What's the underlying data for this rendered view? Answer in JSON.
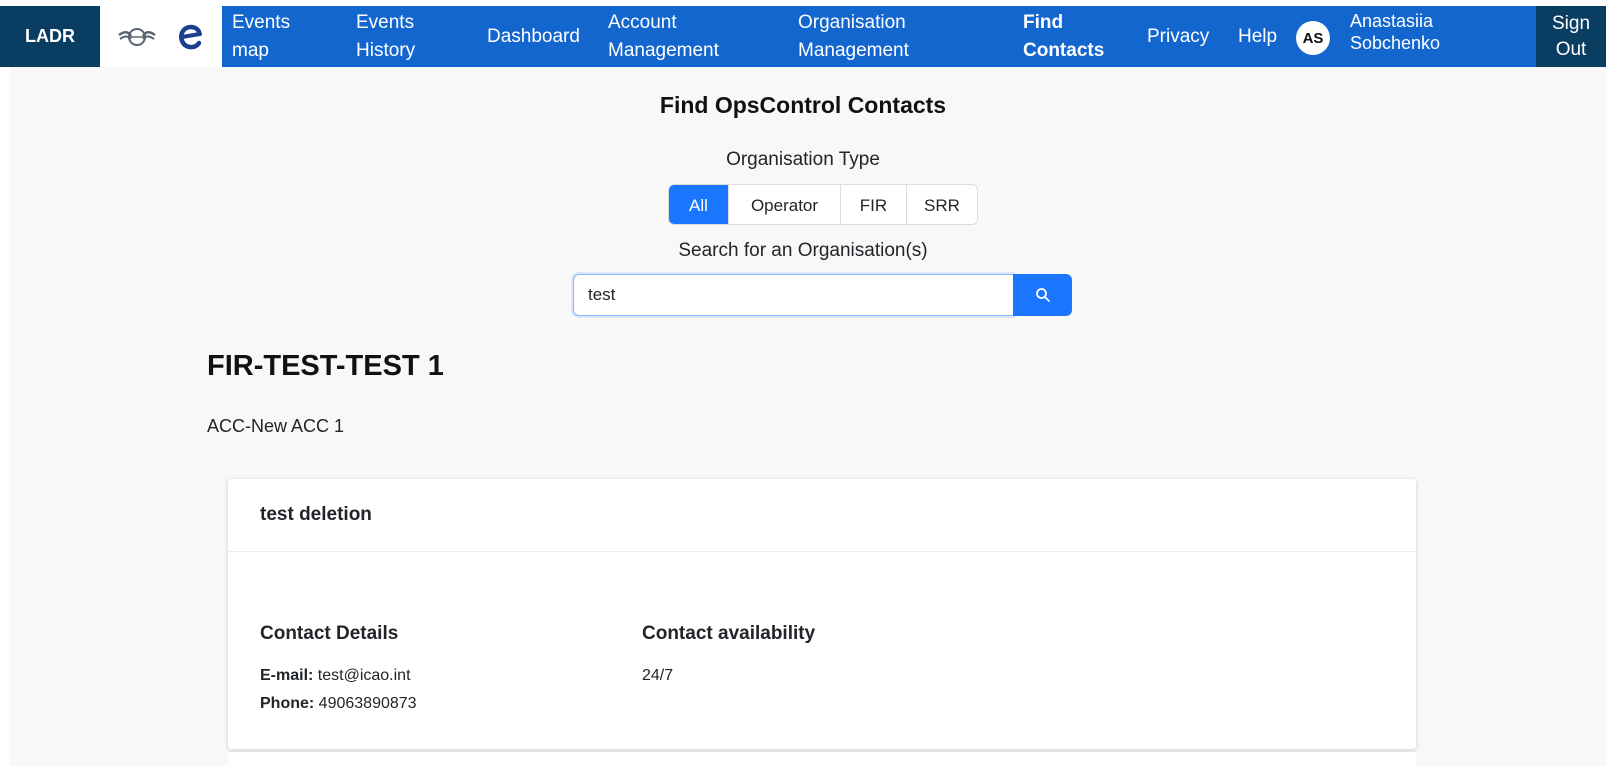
{
  "brand": "LADR",
  "nav": {
    "events_map": "Events\nmap",
    "events_history": "Events\nHistory",
    "dashboard": "Dashboard",
    "account_management": "Account\nManagement",
    "organisation_management": "Organisation\nManagement",
    "find_contacts": "Find\nContacts",
    "privacy": "Privacy",
    "help": "Help"
  },
  "user": {
    "initials": "AS",
    "name": "Anastasiia\nSobchenko"
  },
  "signout": "Sign\nOut",
  "page_title": "Find OpsControl Contacts",
  "filter": {
    "label": "Organisation Type",
    "options": [
      "All",
      "Operator",
      "FIR",
      "SRR"
    ],
    "selected": "All"
  },
  "search": {
    "label": "Search for an Organisation(s)",
    "value": "test"
  },
  "result": {
    "heading": "FIR-TEST-TEST 1",
    "subheading": "ACC-New ACC 1",
    "card": {
      "title": "test deletion",
      "contact_details_title": "Contact Details",
      "email_label": "E-mail:",
      "email": "test@icao.int",
      "phone_label": "Phone:",
      "phone": "49063890873",
      "availability_title": "Contact availability",
      "availability": "24/7"
    }
  },
  "colors": {
    "navbar": "#1466cf",
    "navbar_dark": "#0a3d62",
    "primary": "#1a75ff"
  }
}
